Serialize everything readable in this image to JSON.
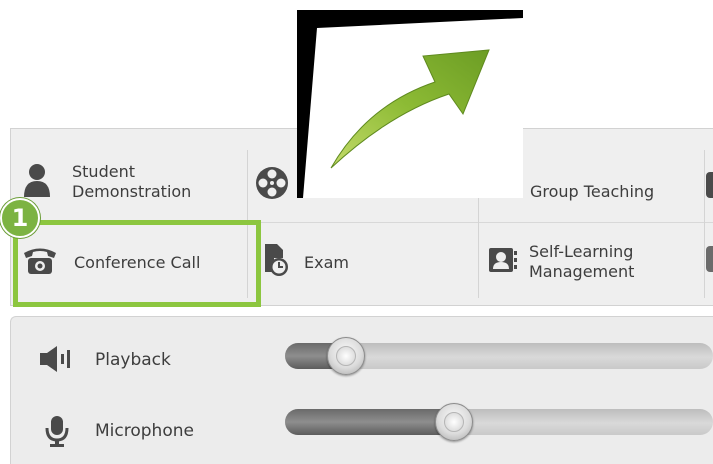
{
  "grid": {
    "row1": [
      {
        "label": "Student\nDemonstration",
        "icon": "person-icon"
      },
      {
        "label": "",
        "icon": "film-reel-icon"
      },
      {
        "label": "Group Teaching",
        "icon": ""
      },
      {
        "label": "",
        "icon": "partial-icon"
      }
    ],
    "row2": [
      {
        "label": "Conference Call",
        "icon": "telephone-icon"
      },
      {
        "label": "Exam",
        "icon": "exam-clock-icon"
      },
      {
        "label": "Self-Learning\nManagement",
        "icon": "self-learning-icon"
      },
      {
        "label": "",
        "icon": "partial-icon"
      }
    ]
  },
  "audio": {
    "playback": {
      "label": "Playback",
      "icon": "speaker-icon",
      "level": 0.1
    },
    "microphone": {
      "label": "Microphone",
      "icon": "microphone-icon",
      "level": 0.38
    }
  },
  "callout": {
    "number": "1",
    "color": "#8cc63f"
  },
  "arrow": {
    "icon": "green-arrow-icon",
    "color": "#7fae2e"
  }
}
